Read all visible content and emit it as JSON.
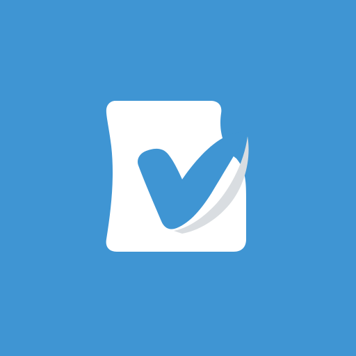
{
  "app_icon": {
    "icon_name": "checkmark-checkbox-icon",
    "colors": {
      "background": "#3F95D3",
      "check": "#3F95D3",
      "card": "#FFFFFF",
      "shadow": "#D9DDE1"
    }
  }
}
